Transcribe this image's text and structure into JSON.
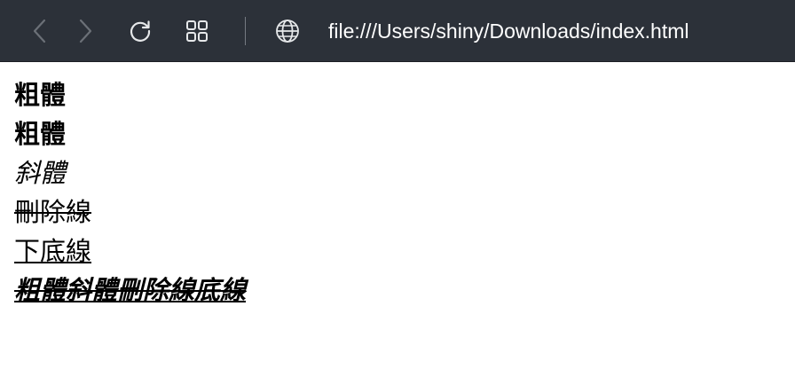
{
  "toolbar": {
    "icons": {
      "back": "chevron-left-icon",
      "forward": "chevron-right-icon",
      "reload": "reload-icon",
      "tabs": "tab-grid-icon",
      "site": "globe-icon"
    },
    "url": "file:///Users/shiny/Downloads/index.html"
  },
  "content": {
    "lines": [
      "粗體",
      "粗體",
      "斜體",
      "刪除線",
      "下底線",
      "粗體斜體刪除線底線"
    ]
  },
  "colors": {
    "toolbar_bg": "#2c3139",
    "icon_disabled": "#6b7077",
    "icon_enabled": "#e6e8ea",
    "text": "#000000"
  }
}
